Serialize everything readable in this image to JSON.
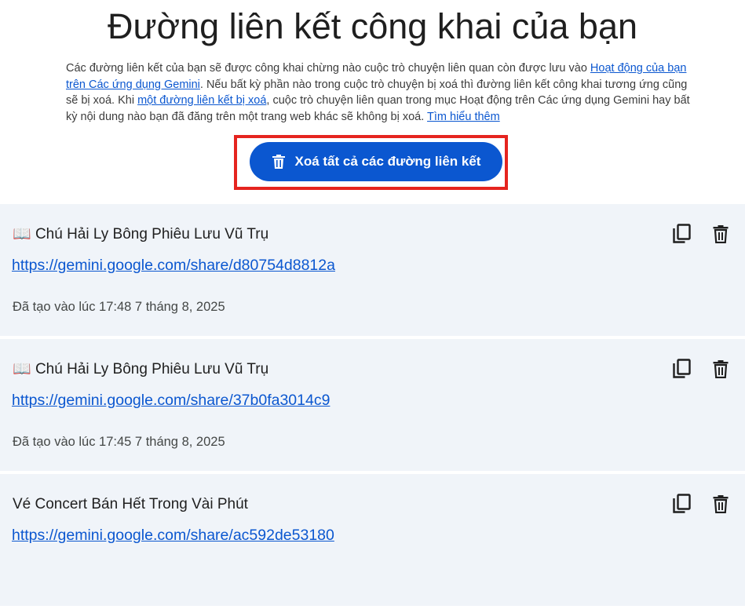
{
  "header": {
    "title": "Đường liên kết công khai của bạn"
  },
  "description": {
    "part1": "Các đường liên kết của bạn sẽ được công khai chừng nào cuộc trò chuyện liên quan còn được lưu vào ",
    "link1": "Hoạt động của bạn trên Các ứng dụng Gemini",
    "part2": ". Nếu bất kỳ phần nào trong cuộc trò chuyện bị xoá thì đường liên kết công khai tương ứng cũng sẽ bị xoá. Khi ",
    "link2": "một đường liên kết bị xoá",
    "part3": ", cuộc trò chuyện liên quan trong mục Hoạt động trên Các ứng dụng Gemini hay bất kỳ nội dung nào bạn đã đăng trên một trang web khác sẽ không bị xoá. ",
    "link3": "Tìm hiểu thêm"
  },
  "actions": {
    "delete_all_label": "Xoá tất cả các đường liên kết",
    "delete_all_icon": "trash-icon",
    "highlight_color": "#e5241f",
    "accent_color": "#0b57d0"
  },
  "links": [
    {
      "emoji": "📖",
      "title": "Chú Hải Ly Bông Phiêu Lưu Vũ Trụ",
      "url": "https://gemini.google.com/share/d80754d8812a",
      "created": "Đã tạo vào lúc 17:48 7 tháng 8, 2025"
    },
    {
      "emoji": "📖",
      "title": "Chú Hải Ly Bông Phiêu Lưu Vũ Trụ",
      "url": "https://gemini.google.com/share/37b0fa3014c9",
      "created": "Đã tạo vào lúc 17:45 7 tháng 8, 2025"
    },
    {
      "emoji": "",
      "title": "Vé Concert Bán Hết Trong Vài Phút",
      "url": "https://gemini.google.com/share/ac592de53180",
      "created": ""
    }
  ],
  "icons": {
    "copy": "copy-icon",
    "delete": "trash-icon"
  }
}
